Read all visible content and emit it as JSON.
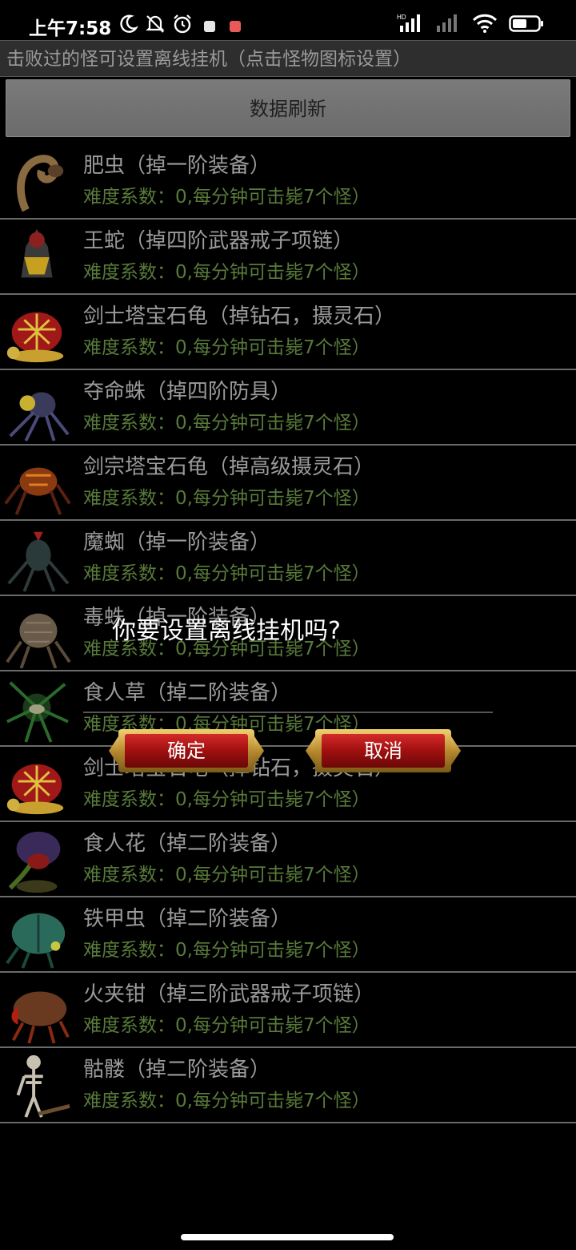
{
  "status_bar": {
    "time": "上午7:58",
    "icons": [
      "moon-icon",
      "mute-icon",
      "alarm-icon",
      "app-notification-icon",
      "app-notification-icon-2",
      "signal-icon",
      "signal-weak-icon",
      "wifi-icon",
      "battery-icon"
    ],
    "hd": "HD"
  },
  "header": {
    "tip": "击败过的怪可设置离线挂机（点击怪物图标设置）",
    "refresh_label": "数据刷新"
  },
  "monsters": [
    {
      "name": "肥虫（掉一阶装备）",
      "info": "难度系数：0,每分钟可击毙7个怪）",
      "icon": "worm-icon"
    },
    {
      "name": "王蛇（掉四阶武器戒子项链）",
      "info": "难度系数：0,每分钟可击毙7个怪）",
      "icon": "serpent-king-icon"
    },
    {
      "name": "剑士塔宝石龟（掉钻石，摄灵石）",
      "info": "难度系数：0,每分钟可击毙7个怪）",
      "icon": "turtle-icon"
    },
    {
      "name": "夺命蛛（掉四阶防具）",
      "info": "难度系数：0,每分钟可击毙7个怪）",
      "icon": "spider-icon"
    },
    {
      "name": "剑宗塔宝石龟（掉高级摄灵石）",
      "info": "难度系数：0,每分钟可击毙7个怪）",
      "icon": "lava-spider-icon"
    },
    {
      "name": "魔蜘（掉一阶装备）",
      "info": "难度系数：0,每分钟可击毙7个怪）",
      "icon": "demon-spider-icon"
    },
    {
      "name": "毒蛛（掉一阶装备）",
      "info": "难度系数：0,每分钟可击毙7个怪）",
      "icon": "poison-spider-icon"
    },
    {
      "name": "食人草（掉二阶装备）",
      "info": "难度系数：0,每分钟可击毙7个怪）",
      "icon": "maneater-plant-icon"
    },
    {
      "name": "剑士塔宝石龟（掉钻石，摄灵石）",
      "info": "难度系数：0,每分钟可击毙7个怪）",
      "icon": "turtle-icon"
    },
    {
      "name": "食人花（掉二阶装备）",
      "info": "难度系数：0,每分钟可击毙7个怪）",
      "icon": "maneater-flower-icon"
    },
    {
      "name": "铁甲虫（掉二阶装备）",
      "info": "难度系数：0,每分钟可击毙7个怪）",
      "icon": "armored-beetle-icon"
    },
    {
      "name": "火夹钳（掉三阶武器戒子项链）",
      "info": "难度系数：0,每分钟可击毙7个怪）",
      "icon": "fire-pincer-icon"
    },
    {
      "name": "骷髅（掉二阶装备）",
      "info": "难度系数：0,每分钟可击毙7个怪）",
      "icon": "skeleton-icon"
    }
  ],
  "dialog": {
    "title": "你要设置离线挂机吗?",
    "confirm_label": "确定",
    "cancel_label": "取消"
  },
  "colors": {
    "background": "#000000",
    "header_bg": "#2e2e2e",
    "name_text": "#9a9a9a",
    "info_text": "#587a3a",
    "button_red": "#b01818",
    "button_gold": "#c8a040"
  }
}
